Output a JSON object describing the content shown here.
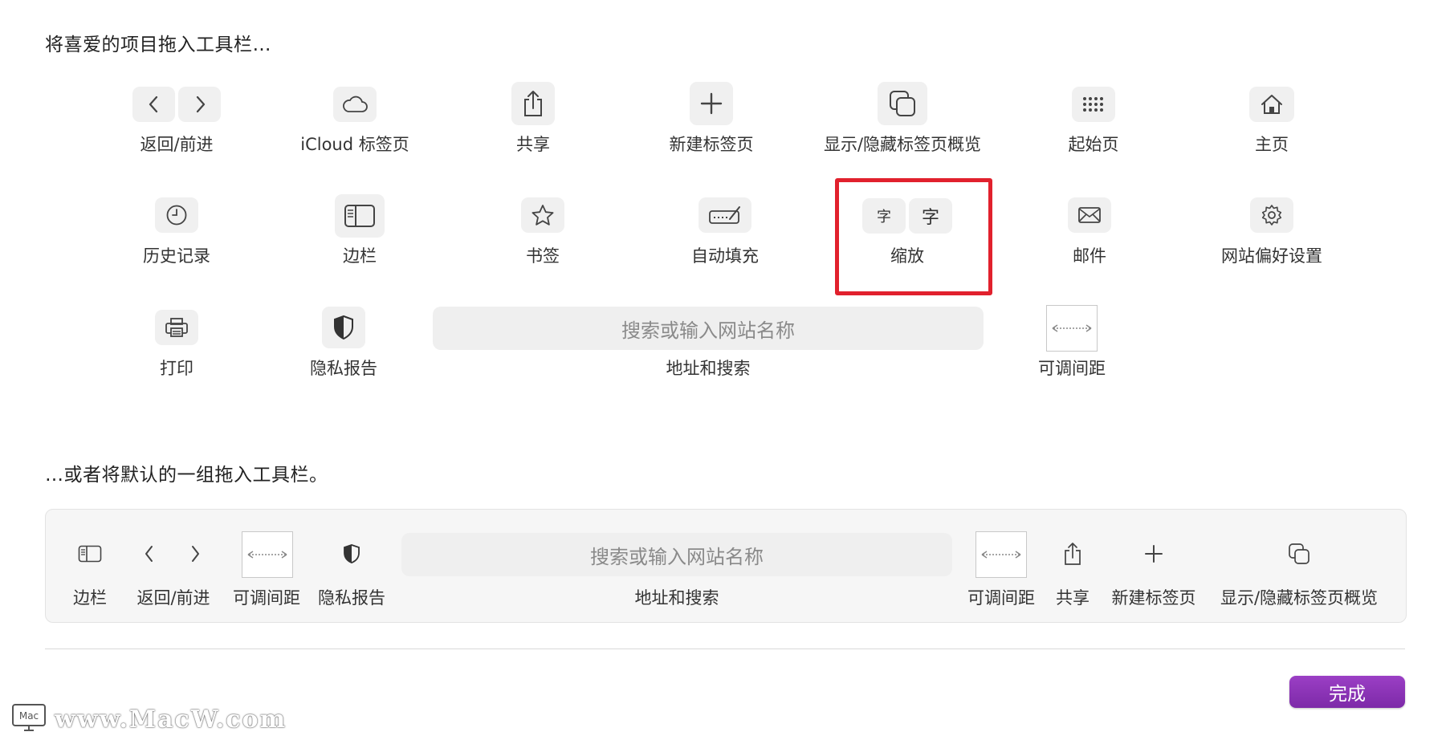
{
  "header": {
    "drag_items_title": "将喜爱的项目拖入工具栏…",
    "drag_default_title": "…或者将默认的一组拖入工具栏。"
  },
  "items": {
    "back_forward": "返回/前进",
    "icloud_tabs": "iCloud 标签页",
    "share": "共享",
    "new_tab": "新建标签页",
    "tab_overview": "显示/隐藏标签页概览",
    "start_page": "起始页",
    "home": "主页",
    "history": "历史记录",
    "sidebar": "边栏",
    "bookmarks": "书签",
    "autofill": "自动填充",
    "zoom": "缩放",
    "zoom_glyph": "字",
    "mail": "邮件",
    "website_prefs": "网站偏好设置",
    "print": "打印",
    "privacy_report": "隐私报告",
    "address_search": "地址和搜索",
    "search_placeholder": "搜索或输入网站名称",
    "flexible_space": "可调间距"
  },
  "default_set": {
    "sidebar": "边栏",
    "back_forward": "返回/前进",
    "flexible_space_1": "可调间距",
    "privacy_report": "隐私报告",
    "search_placeholder": "搜索或输入网站名称",
    "address_search": "地址和搜索",
    "flexible_space_2": "可调间距",
    "share": "共享",
    "new_tab": "新建标签页",
    "tab_overview": "显示/隐藏标签页概览"
  },
  "footer": {
    "done_label": "完成"
  },
  "watermark": {
    "text": "www.MacW.com"
  },
  "colors": {
    "highlight": "#e1212d",
    "done_button": "#8a33b8",
    "icon_bg": "#f0f0f0"
  }
}
